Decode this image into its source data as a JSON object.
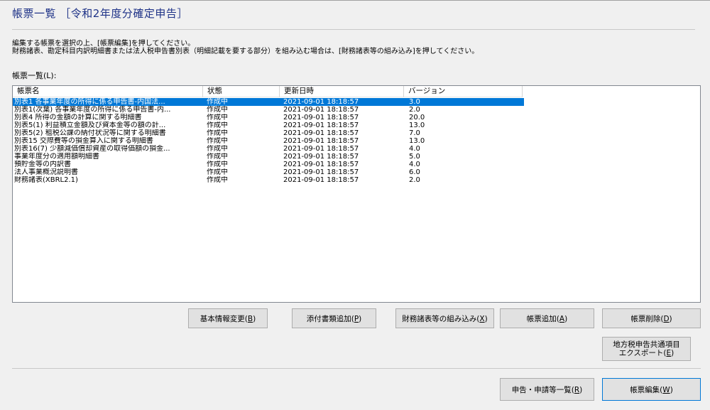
{
  "window": {
    "title": "帳票一覧 ［令和2年度分確定申告］"
  },
  "instructions": [
    "編集する帳票を選択の上、[帳票編集]を押してください。",
    "財務諸表、勘定科目内訳明細書または法人税申告書別表（明細記載を要する部分）を組み込む場合は、[財務諸表等の組み込み]を押してください。"
  ],
  "list": {
    "label": "帳票一覧(L):",
    "columns": [
      "帳票名",
      "状態",
      "更新日時",
      "バージョン"
    ],
    "rows": [
      {
        "name": "別表1 各事業年度の所得に係る申告書-内国法...",
        "status": "作成中",
        "updated": "2021-09-01 18:18:57",
        "version": "3.0",
        "selected": true
      },
      {
        "name": "別表1(次葉) 各事業年度の所得に係る申告書-内...",
        "status": "作成中",
        "updated": "2021-09-01 18:18:57",
        "version": "2.0"
      },
      {
        "name": "別表4 所得の金額の計算に関する明細書",
        "status": "作成中",
        "updated": "2021-09-01 18:18:57",
        "version": "20.0"
      },
      {
        "name": "別表5(1) 利益積立金額及び資本金等の額の計...",
        "status": "作成中",
        "updated": "2021-09-01 18:18:57",
        "version": "13.0"
      },
      {
        "name": "別表5(2) 租税公課の納付状況等に関する明細書",
        "status": "作成中",
        "updated": "2021-09-01 18:18:57",
        "version": "7.0"
      },
      {
        "name": "別表15 交際費等の損金算入に関する明細書",
        "status": "作成中",
        "updated": "2021-09-01 18:18:57",
        "version": "13.0"
      },
      {
        "name": "別表16(7) 少額減価償却資産の取得価額の損金...",
        "status": "作成中",
        "updated": "2021-09-01 18:18:57",
        "version": "4.0"
      },
      {
        "name": "事業年度分の適用額明細書",
        "status": "作成中",
        "updated": "2021-09-01 18:18:57",
        "version": "5.0"
      },
      {
        "name": "預貯金等の内訳書",
        "status": "作成中",
        "updated": "2021-09-01 18:18:57",
        "version": "4.0"
      },
      {
        "name": "法人事業概況説明書",
        "status": "作成中",
        "updated": "2021-09-01 18:18:57",
        "version": "6.0"
      },
      {
        "name": "財務諸表(XBRL2.1)",
        "status": "作成中",
        "updated": "2021-09-01 18:18:57",
        "version": "2.0"
      }
    ]
  },
  "buttons": {
    "basic_info": {
      "text": "基本情報変更(",
      "key": "B",
      "end": ")"
    },
    "attach": {
      "text": "添付書類追加(",
      "key": "P",
      "end": ")"
    },
    "financial": {
      "text": "財務諸表等の組み込み(",
      "key": "X",
      "end": ")"
    },
    "add": {
      "text": "帳票追加(",
      "key": "A",
      "end": ")"
    },
    "delete": {
      "text": "帳票削除(",
      "key": "D",
      "end": ")"
    },
    "export_line1": "地方税申告共通項目",
    "export": {
      "text": "エクスポート(",
      "key": "E",
      "end": ")"
    },
    "filings": {
      "text": "申告・申請等一覧(",
      "key": "R",
      "end": ")"
    },
    "edit": {
      "text": "帳票編集(",
      "key": "W",
      "end": ")"
    }
  }
}
